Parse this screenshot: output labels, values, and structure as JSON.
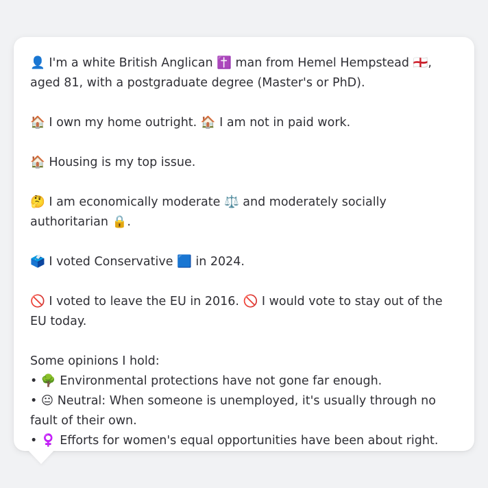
{
  "persona": {
    "intro": "👤 I'm a white British Anglican ✝️ man from Hemel Hempstead 🏴󠁧󠁢󠁥󠁮󠁧󠁿, aged 81, with a postgraduate degree (Master's or PhD).",
    "housing_status": "🏠 I own my home outright. 🏠 I am not in paid work.",
    "top_issue": "🏠 Housing is my top issue.",
    "ideology": "🤔 I am economically moderate ⚖️ and moderately socially authoritarian 🔒.",
    "vote_2024": "🗳️ I voted Conservative 🟦 in 2024.",
    "eu_vote": "🚫 I voted to leave the EU in 2016. 🚫 I would vote to stay out of the EU today.",
    "opinions_heading": "Some opinions I hold:",
    "opinions": [
      "• 🌳 Environmental protections have not gone far enough.",
      "• 😐 Neutral: When someone is unemployed, it's usually through no fault of their own.",
      "• ♀️ Efforts for women's equal opportunities have been about right."
    ]
  }
}
